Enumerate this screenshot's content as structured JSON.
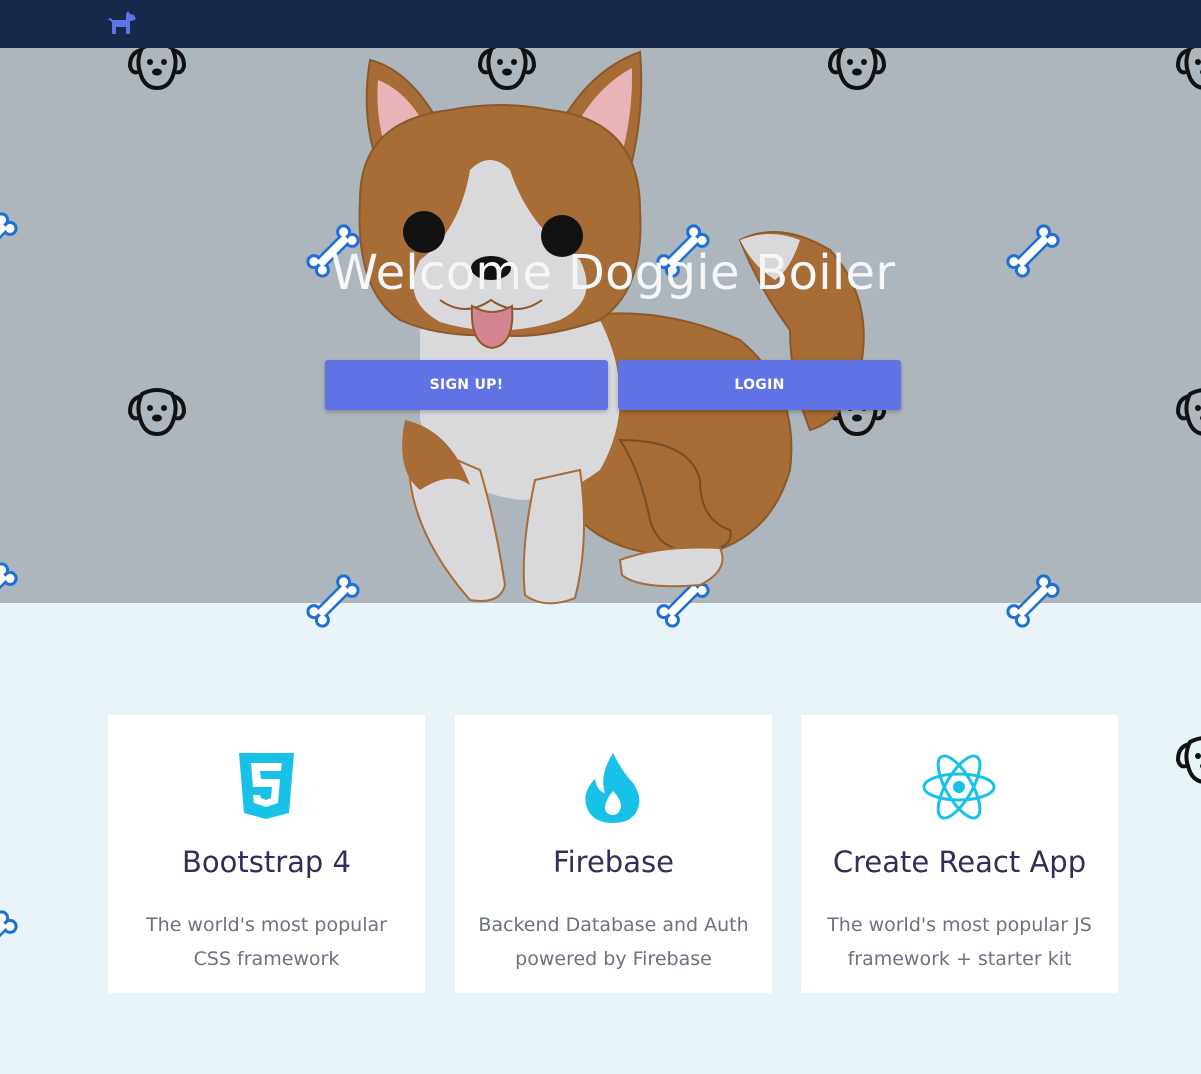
{
  "navbar": {
    "logo_icon": "dog-icon",
    "brand_color": "#5f73e4",
    "background": "#17294b"
  },
  "hero": {
    "title": "Welcome Doggie Boiler",
    "signup_label": "SIGN UP!",
    "login_label": "LOGIN",
    "background": "#adb5bd"
  },
  "features": [
    {
      "icon": "css3-icon",
      "title": "Bootstrap 4",
      "description": "The world's most popular CSS framework"
    },
    {
      "icon": "firebase-flame-icon",
      "title": "Firebase",
      "description": "Backend Database and Auth powered by Firebase"
    },
    {
      "icon": "react-atom-icon",
      "title": "Create React App",
      "description": "The world's most popular JS framework + starter kit"
    }
  ],
  "colors": {
    "accent": "#5f73e4",
    "icon_cyan": "#17c1e8",
    "page_bg": "#e9f4f8",
    "bone_blue": "#1e6fd6"
  }
}
